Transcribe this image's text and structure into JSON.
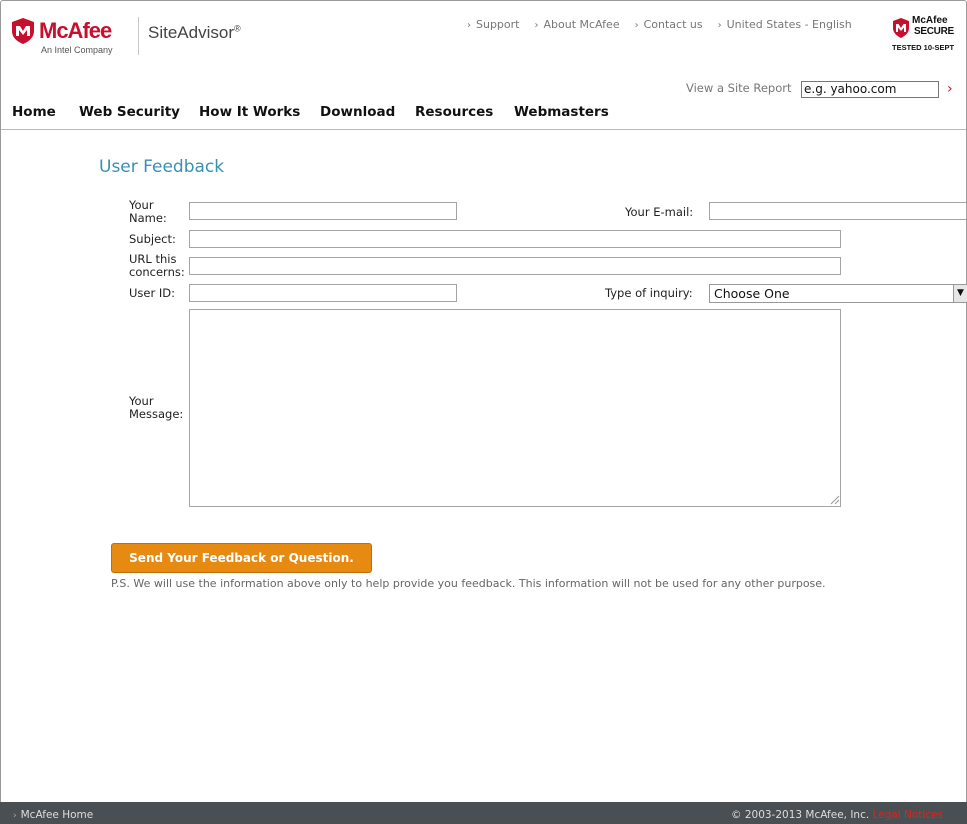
{
  "header": {
    "brand": "McAfee",
    "brand_sub": "An Intel Company",
    "product": "SiteAdvisor",
    "product_mark": "®",
    "top_links": [
      {
        "label": "Support"
      },
      {
        "label": "About McAfee"
      },
      {
        "label": "Contact us"
      },
      {
        "label": "United States - English"
      }
    ],
    "secure_badge": {
      "brand": "McAfee",
      "word": "SECURE",
      "tested": "TESTED 10-SEPT"
    },
    "site_report": {
      "label": "View a Site Report",
      "input_value": "e.g. yahoo.com",
      "go_icon": "chevron-right-icon"
    },
    "nav": [
      {
        "label": "Home"
      },
      {
        "label": "Web Security"
      },
      {
        "label": "How It Works"
      },
      {
        "label": "Download"
      },
      {
        "label": "Resources"
      },
      {
        "label": "Webmasters"
      }
    ]
  },
  "form": {
    "title": "User Feedback",
    "name_label_line1": "Your",
    "name_label_line2": "Name:",
    "name_value": "",
    "email_label": "Your E-mail:",
    "email_value": "",
    "subject_label": "Subject:",
    "subject_value": "",
    "url_label_line1": "URL this",
    "url_label_line2": "concerns:",
    "url_value": "",
    "userid_label": "User ID:",
    "userid_value": "",
    "inquiry_label": "Type of inquiry:",
    "inquiry_selected": "Choose One",
    "message_label_line1": "Your",
    "message_label_line2": "Message:",
    "message_value": "",
    "submit_label": "Send Your Feedback or Question.",
    "ps_note": "P.S. We will use the information above only to help provide you feedback. This information will not be used for any other purpose."
  },
  "footer": {
    "home_link": "McAfee Home",
    "copyright": "© 2003-2013 McAfee, Inc.",
    "legal_link": "Legal Notices"
  },
  "colors": {
    "brand_red": "#c8102e",
    "title_blue": "#3a8fb7",
    "button_orange": "#e68a12",
    "footer_bg": "#4a4f54"
  }
}
